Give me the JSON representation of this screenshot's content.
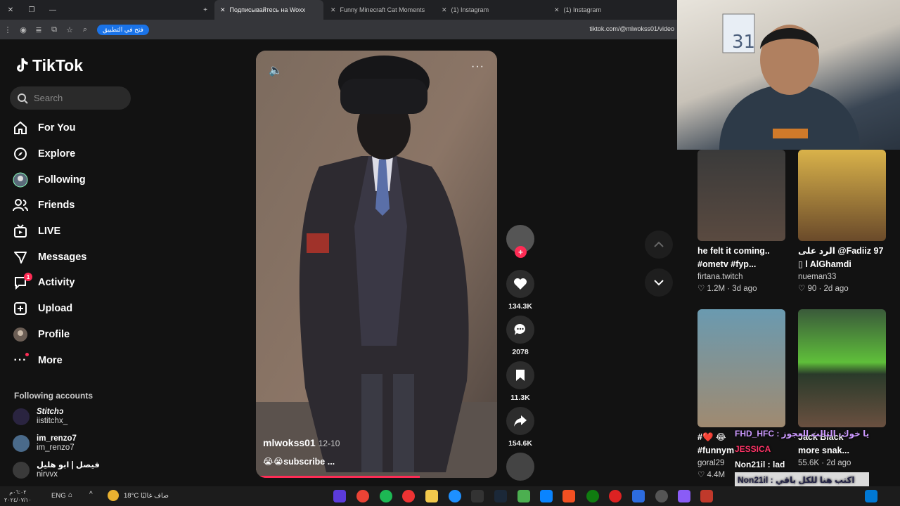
{
  "browser": {
    "tabs": [
      {
        "title": "Подписывайтесь на Woxx"
      },
      {
        "title": "Funny Minecraft Cat Moments"
      },
      {
        "title": "(1) Instagram"
      },
      {
        "title": "(1) Instagram"
      }
    ],
    "open_app_label": "فتح في التطبيق",
    "url": "tiktok.com/@mlwokss01/video"
  },
  "sidebar": {
    "logo": "TikTok",
    "search_placeholder": "Search",
    "nav": [
      {
        "label": "For You",
        "icon": "home-icon"
      },
      {
        "label": "Explore",
        "icon": "compass-icon"
      },
      {
        "label": "Following",
        "icon": "following-avatar-icon"
      },
      {
        "label": "Friends",
        "icon": "friends-icon"
      },
      {
        "label": "LIVE",
        "icon": "live-icon"
      },
      {
        "label": "Messages",
        "icon": "messages-icon"
      },
      {
        "label": "Activity",
        "icon": "activity-icon",
        "badge": "1"
      },
      {
        "label": "Upload",
        "icon": "upload-icon"
      },
      {
        "label": "Profile",
        "icon": "profile-avatar-icon"
      },
      {
        "label": "More",
        "icon": "more-dots-icon"
      }
    ],
    "following_header": "Following accounts",
    "accounts": [
      {
        "name": "Stitchↄ",
        "handle": "iistitchx_"
      },
      {
        "name": "im_renzo7",
        "handle": "im_renzo7"
      },
      {
        "name": "فيصل | ابو هليل",
        "handle": "nirvvx"
      }
    ]
  },
  "video": {
    "username": "mlwokss01",
    "date": "12-10",
    "caption": "😭😭subscribe ...",
    "progress": 0.68,
    "likes": "134.3K",
    "comments": "2078",
    "saves": "11.3K",
    "shares": "154.6K"
  },
  "feed": {
    "cards": [
      {
        "title": "he felt it coming..",
        "title2": "#ometv #fyp...",
        "author": "firtana.twitch",
        "meta": "♡ 1.2M · 3d ago"
      },
      {
        "title": "الرد على @Fadiiz 97",
        "title2": "▯ l AlGhamdi",
        "author": "nueman33",
        "meta": "♡ 90 · 2d ago"
      },
      {
        "title": "#❤️ 😂",
        "title2": "#funnym",
        "author": "goral29",
        "meta": "♡ 4.4M"
      },
      {
        "title": "Jack Black",
        "title2": "more snak...",
        "author": "",
        "meta": "55.6K · 2d ago"
      }
    ]
  },
  "chat": {
    "lines": [
      "FHD_HFC : يا خوك، الثالث العجوز",
      "JESSICA",
      "Non21il : lad"
    ],
    "input_text": "Non21il : اكتب هنا للكل باقي"
  },
  "taskbar": {
    "time": "٠٦:٠٢م",
    "date": "٢٠٢٤/٠٧/١٠",
    "lang": "ENG",
    "weather": "18°C",
    "weather_desc": "صاف غالبًا"
  },
  "colors": {
    "accent": "#fe2c55",
    "bg": "#121212"
  }
}
